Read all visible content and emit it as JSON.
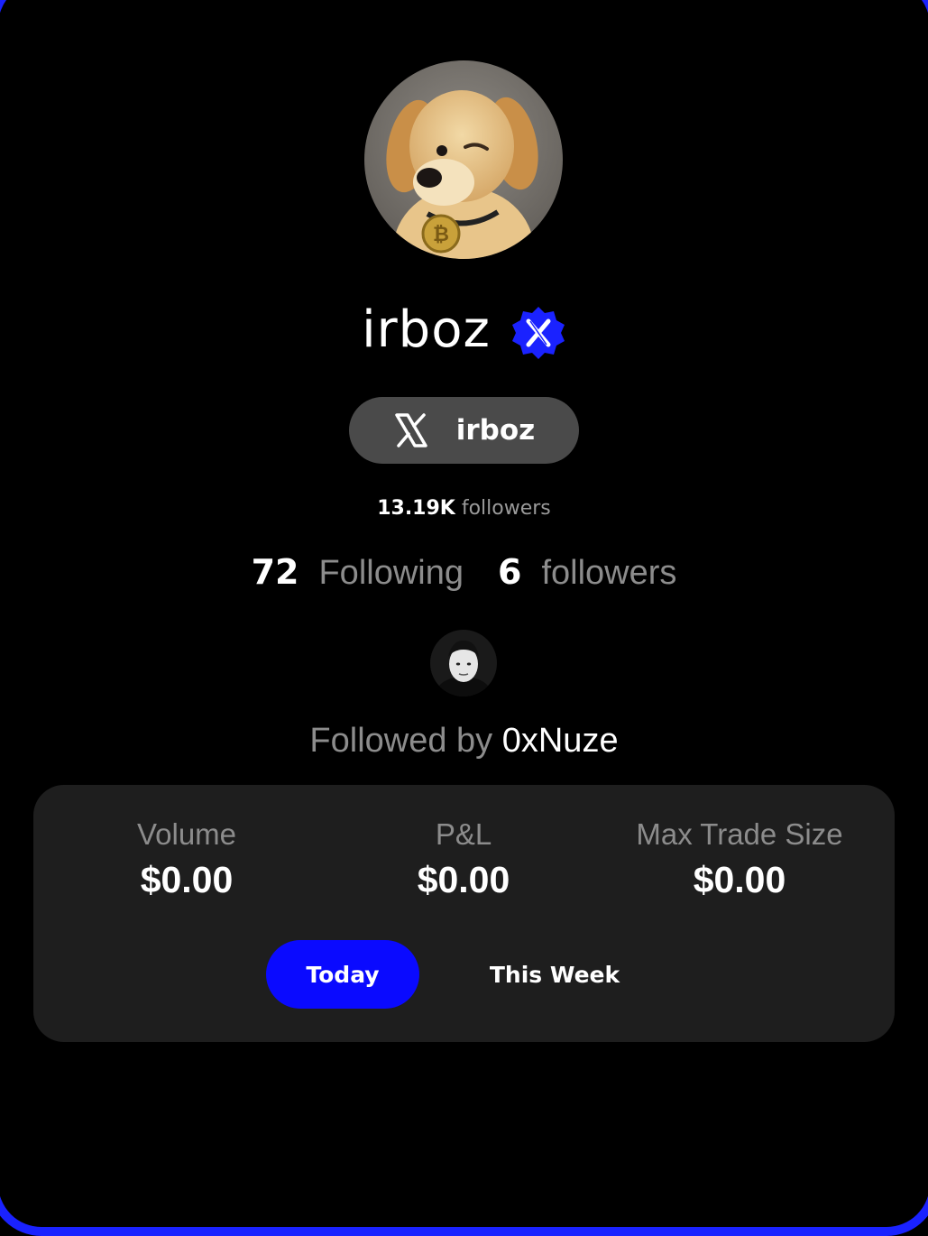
{
  "profile": {
    "display_name": "irboz",
    "verified_badge_icon": "x-verified-badge-icon",
    "avatar": "golden-retriever-puppy-with-bitcoin-medal"
  },
  "x_account": {
    "icon": "x-logo-icon",
    "handle": "irboz",
    "followers_count": "13.19K",
    "followers_label": "followers"
  },
  "social": {
    "following_count": "72",
    "following_label": "Following",
    "followers_count": "6",
    "followers_label": "followers",
    "followed_by_prefix": "Followed by",
    "followed_by_name": "0xNuze"
  },
  "stats": {
    "volume_label": "Volume",
    "volume_value": "$0.00",
    "pnl_label": "P&L",
    "pnl_value": "$0.00",
    "max_trade_label": "Max Trade Size",
    "max_trade_value": "$0.00"
  },
  "period_tabs": [
    {
      "label": "Today",
      "active": true
    },
    {
      "label": "This Week",
      "active": false
    }
  ],
  "colors": {
    "accent": "#0a0aff",
    "badge": "#1a22ff",
    "pill": "#4a4a4a",
    "card": "#1e1e1e",
    "muted_text": "#8c8c8c"
  }
}
